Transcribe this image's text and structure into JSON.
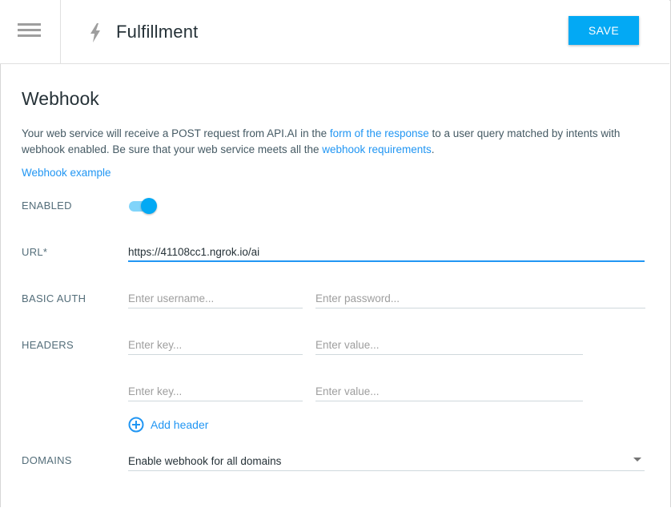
{
  "header": {
    "title": "Fulfillment",
    "save_label": "SAVE"
  },
  "section": {
    "title": "Webhook",
    "desc_1": "Your web service will receive a POST request from API.AI in the ",
    "link_response": "form of the response",
    "desc_2": " to a user query matched by intents with webhook enabled. Be sure that your web service meets all the ",
    "link_requirements": "webhook requirements",
    "desc_3": ".",
    "example_link": "Webhook example"
  },
  "form": {
    "enabled_label": "ENABLED",
    "enabled": true,
    "url_label": "URL*",
    "url_value": "https://41108cc1.ngrok.io/ai",
    "basic_auth_label": "BASIC AUTH",
    "username_placeholder": "Enter username...",
    "password_placeholder": "Enter password...",
    "headers_label": "HEADERS",
    "key_placeholder": "Enter key...",
    "value_placeholder": "Enter value...",
    "add_header_label": "Add header",
    "domains_label": "DOMAINS",
    "domains_selected": "Enable webhook for all domains"
  },
  "colors": {
    "accent": "#03a9f4",
    "link": "#2196f3"
  },
  "icons": [
    "menu-icon",
    "bolt-icon",
    "add-circle-icon",
    "dropdown-caret-icon"
  ]
}
